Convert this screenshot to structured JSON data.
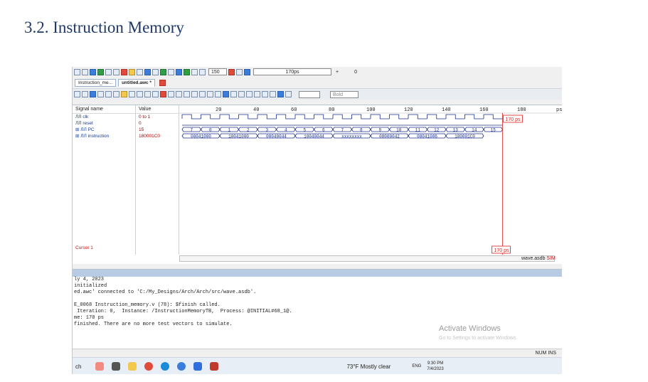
{
  "document": {
    "heading": "3.2. Instruction Memory"
  },
  "toolbar": {
    "iteration_value": "150",
    "time_field": "170ps",
    "plus_label": "+",
    "offset_value": "0"
  },
  "tabs": [
    {
      "label": "Instruction_me..."
    },
    {
      "label": "untitled.awc *"
    }
  ],
  "wave_toolbar": {
    "bold_label": "Bold"
  },
  "waveform": {
    "headers": {
      "signal": "Signal name",
      "value": "Value"
    },
    "signals": [
      {
        "name": "clk",
        "value": "0 to 1",
        "expand": ""
      },
      {
        "name": "reset",
        "value": "0",
        "expand": ""
      },
      {
        "name": "PC",
        "value": "15",
        "expand": "⊞"
      },
      {
        "name": "instruction",
        "value": "180001C0",
        "expand": "⊞"
      }
    ],
    "ruler": [
      "20",
      "40",
      "60",
      "80",
      "100",
      "120",
      "140",
      "160",
      "180",
      "ps"
    ],
    "pc_values": [
      "7",
      "0",
      "1",
      "2",
      "3",
      "4",
      "5",
      "6",
      "7",
      "8",
      "9",
      "10",
      "11",
      "12",
      "13",
      "14",
      "15"
    ],
    "instr_values": [
      "00041000",
      "10041000",
      "00040044",
      "10040044",
      "xxxxxxxx",
      "08000042",
      "08041006",
      "180001C0"
    ],
    "cursor_label": "Cursor 1",
    "cursor_time": "170 ps",
    "cursor_time_bottom": "170 ps",
    "file_label": "wave.asdb",
    "sim_label": "SIM"
  },
  "console": {
    "lines": [
      "ly 4, 2023",
      "initialized",
      "ed.awc' connected to 'C:/My_Designs/Arch/Arch/src/wave.asdb'.",
      "",
      "E_0068 Instruction_memory.v (78): $finish called.",
      " Iteration: 0,  Instance: /InstructionMemoryTB,  Process: @INITIAL#68_1@.",
      "me: 170 ps",
      "finished. There are no more test vectors to simulate."
    ],
    "watermark_title": "Activate Windows",
    "watermark_sub": "Go to Settings to activate Windows."
  },
  "status": {
    "right": "NUM  INS"
  },
  "taskbar": {
    "search_fragment": "ch",
    "weather": "73°F  Mostly clear",
    "lang": "ENG",
    "time": "9:30 PM",
    "date": "7/4/2023"
  },
  "colors": {
    "wave": "#1b2f8a",
    "cursor": "#e02020",
    "heading": "#1f3864"
  }
}
